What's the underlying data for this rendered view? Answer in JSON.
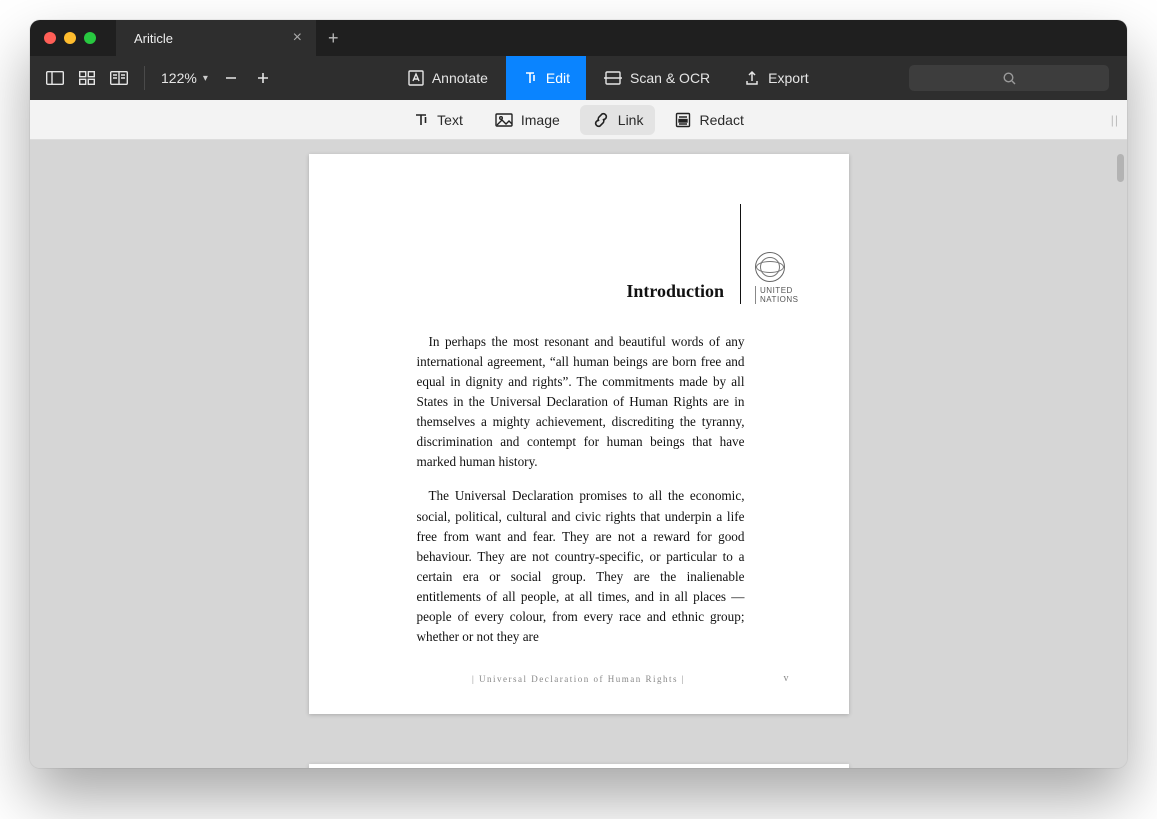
{
  "titlebar": {
    "tab_title": "Ariticle"
  },
  "toolbar": {
    "zoom_label": "122%",
    "annotate": "Annotate",
    "edit": "Edit",
    "scan_ocr": "Scan & OCR",
    "export": "Export"
  },
  "subtool": {
    "text": "Text",
    "image": "Image",
    "link": "Link",
    "redact": "Redact"
  },
  "document": {
    "section_title": "Introduction",
    "logo_line1": "UNITED",
    "logo_line2": "NATIONS",
    "para1": "In perhaps the most resonant and beautiful words of any international agreement, “all human beings are born free and equal in dignity and rights”. The commitments made by all States in the Universal Declaration of Human Rights are in themselves a mighty achievement, discrediting the tyranny, discrimination and contempt for human beings that have marked human history.",
    "para2": "The Universal Declaration promises to all the economic, social, political, cultural and civic rights that underpin a life free from want and fear. They are not a reward for good behaviour. They are not country-specific, or particular to a certain era or social group.  They are the inalienable entitlements of all people, at all times, and in all places — people of every colour, from every race and ethnic group; whether or not they are",
    "footer_text": "|  Universal Declaration of Human Rights  |",
    "page_number": "v"
  }
}
